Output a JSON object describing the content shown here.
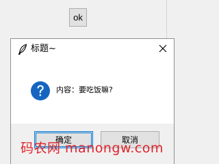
{
  "top_button": {
    "label": "ok"
  },
  "dialog": {
    "title": "标题~",
    "message": "内容：要吃饭嘛?",
    "buttons": {
      "confirm": "确定",
      "cancel": "取消"
    }
  },
  "watermark": {
    "text": "码农网 manongw.com"
  },
  "colors": {
    "accent": "#0078d7",
    "question_icon": "#1565c0",
    "watermark": "#e0222a"
  }
}
